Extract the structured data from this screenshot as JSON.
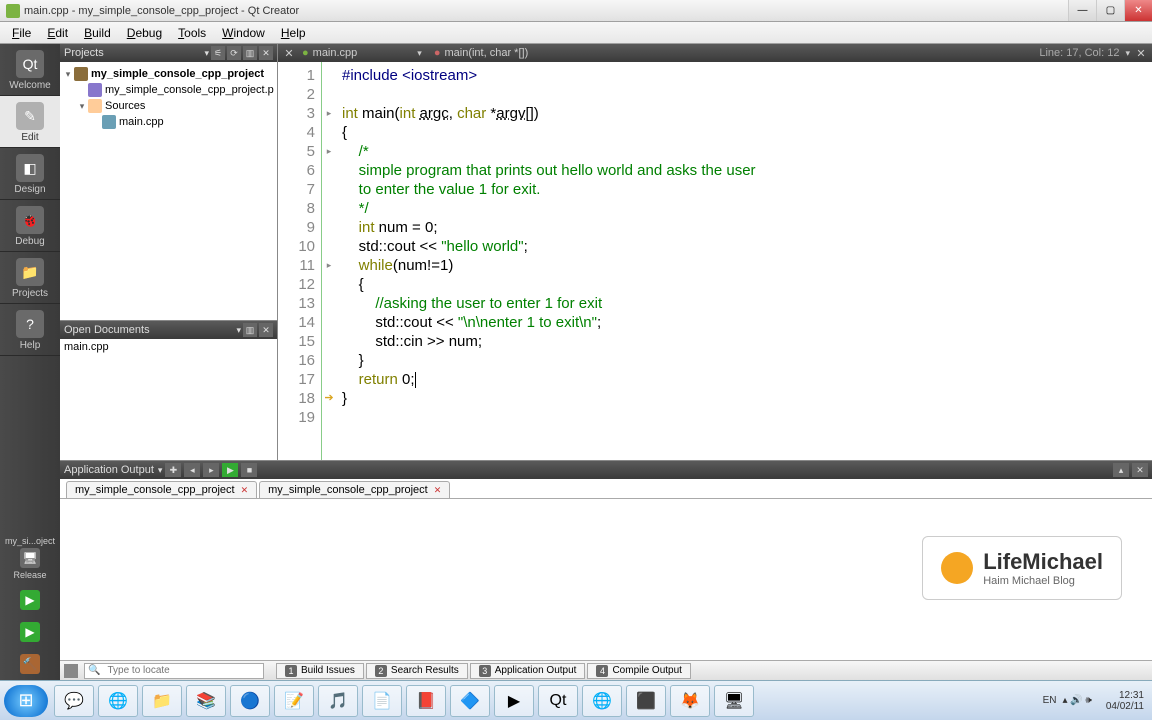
{
  "window": {
    "title": "main.cpp - my_simple_console_cpp_project - Qt Creator"
  },
  "menu": [
    "File",
    "Edit",
    "Build",
    "Debug",
    "Tools",
    "Window",
    "Help"
  ],
  "sidebar": {
    "items": [
      {
        "label": "Welcome",
        "icon": "Qt"
      },
      {
        "label": "Edit",
        "icon": "✎"
      },
      {
        "label": "Design",
        "icon": "◧"
      },
      {
        "label": "Debug",
        "icon": "🐞"
      },
      {
        "label": "Projects",
        "icon": "📁"
      },
      {
        "label": "Help",
        "icon": "?"
      }
    ],
    "target": {
      "label": "my_si...oject",
      "config": "Release"
    }
  },
  "projects_pane": {
    "header": "Projects",
    "tree": [
      {
        "name": "my_simple_console_cpp_project",
        "bold": true,
        "icon": "proj",
        "indent": 0,
        "arrow": "▾"
      },
      {
        "name": "my_simple_console_cpp_project.p",
        "icon": "file",
        "indent": 1,
        "arrow": ""
      },
      {
        "name": "Sources",
        "icon": "folder",
        "indent": 1,
        "arrow": "▾"
      },
      {
        "name": "main.cpp",
        "icon": "cpp",
        "indent": 2,
        "arrow": ""
      }
    ]
  },
  "opendocs": {
    "header": "Open Documents",
    "items": [
      "main.cpp"
    ]
  },
  "editor": {
    "file_tab": "main.cpp",
    "symbol_tab": "main(int, char *[])",
    "status": "Line: 17, Col: 12",
    "lines": [
      {
        "n": 1,
        "html": "<span class='pp'>#include</span> <span class='pp'>&lt;iostream&gt;</span>"
      },
      {
        "n": 2,
        "html": ""
      },
      {
        "n": 3,
        "html": "<span class='kw'>int</span> main(<span class='kw'>int</span> <span class='id-u'>argc</span>, <span class='kw'>char</span> *<span class='id-u'>argv</span>[])",
        "mark": "▸"
      },
      {
        "n": 4,
        "html": "{"
      },
      {
        "n": 5,
        "html": "    <span class='com'>/*</span>",
        "mark": "▸"
      },
      {
        "n": 6,
        "html": "    <span class='com'>simple program that prints out hello world and asks the user</span>"
      },
      {
        "n": 7,
        "html": "    <span class='com'>to enter the value 1 for exit.</span>"
      },
      {
        "n": 8,
        "html": "    <span class='com'>*/</span>"
      },
      {
        "n": 9,
        "html": "    <span class='kw'>int</span> num = <span>0</span>;"
      },
      {
        "n": 10,
        "html": "    std::cout &lt;&lt; <span class='str'>\"hello world\"</span>;"
      },
      {
        "n": 11,
        "html": "    <span class='kw'>while</span>(num!=<span>1</span>)",
        "mark": "▸"
      },
      {
        "n": 12,
        "html": "    {"
      },
      {
        "n": 13,
        "html": "        <span class='com'>//asking the user to enter 1 for exit</span>"
      },
      {
        "n": 14,
        "html": "        std::cout &lt;&lt; <span class='str'>\"\\n\\nenter 1 to exit\\n\"</span>;"
      },
      {
        "n": 15,
        "html": "        std::cin &gt;&gt; num;"
      },
      {
        "n": 16,
        "html": "    }"
      },
      {
        "n": 17,
        "html": "    <span class='kw'>return</span> <span>0</span>;<span class='cursor'></span>"
      },
      {
        "n": 18,
        "html": "}",
        "marker": "arrow"
      },
      {
        "n": 19,
        "html": ""
      }
    ]
  },
  "output": {
    "header": "Application Output",
    "tabs": [
      "my_simple_console_cpp_project",
      "my_simple_console_cpp_project"
    ]
  },
  "watermark": {
    "brand": "LifeMichael",
    "sub": "Haim Michael Blog"
  },
  "status_tabs": [
    {
      "n": "1",
      "label": "Build Issues"
    },
    {
      "n": "2",
      "label": "Search Results"
    },
    {
      "n": "3",
      "label": "Application Output"
    },
    {
      "n": "4",
      "label": "Compile Output"
    }
  ],
  "locator": {
    "placeholder": "Type to locate"
  },
  "taskbar": {
    "lang": "EN",
    "time": "12:31",
    "date": "04/02/11"
  }
}
